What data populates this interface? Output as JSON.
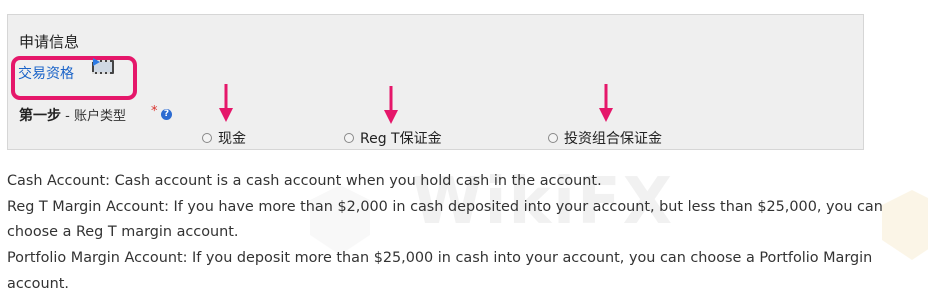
{
  "panel": {
    "heading": "申请信息",
    "trading_link": "交易资格",
    "step_label_bold": "第一步",
    "step_label_rest": " - 账户类型",
    "required_mark": "*",
    "help_glyph": "?"
  },
  "account_types": [
    {
      "label": "现金",
      "selected": false
    },
    {
      "label": "Reg T保证金",
      "selected": false
    },
    {
      "label": "投资组合保证金",
      "selected": false
    }
  ],
  "explanations": [
    "Cash Account: Cash account is a cash account when you hold cash in the account.",
    "Reg T Margin Account: If you have more than $2,000 in cash deposited into your account, but less than $25,000, you can choose a Reg T margin account.",
    "Portfolio Margin Account: If you deposit more than $25,000 in cash into your account, you can choose a Portfolio Margin account."
  ],
  "watermark_text": "WikiFX",
  "colors": {
    "highlight": "#e5176a",
    "arrow": "#e5176a",
    "link": "#1a63c8",
    "panel_bg": "#efefef"
  },
  "icons": [
    "video-icon",
    "help-icon",
    "arrow-down-icon"
  ]
}
